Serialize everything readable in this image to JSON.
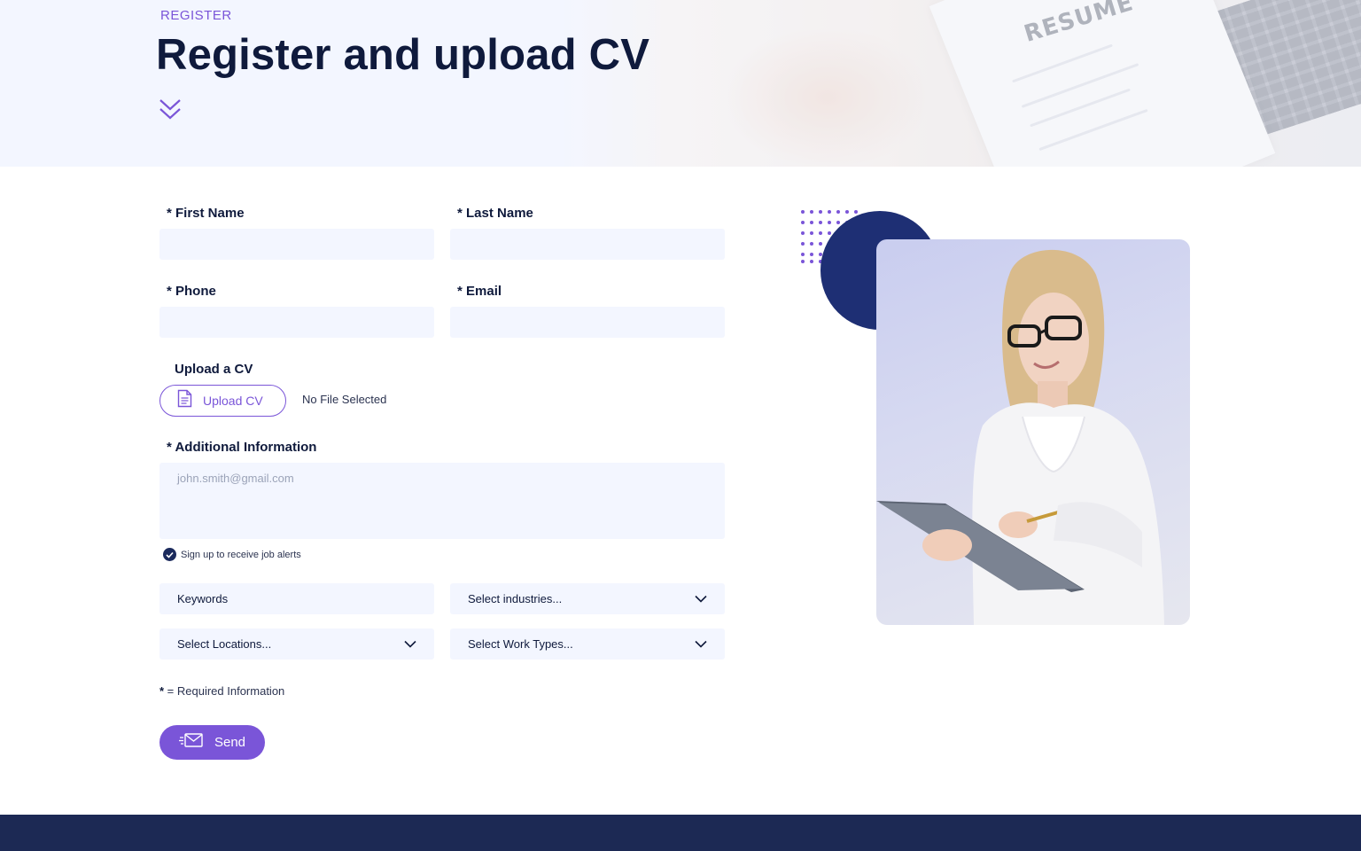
{
  "hero": {
    "eyebrow": "REGISTER",
    "title": "Register and upload CV",
    "background_text": "RESUME",
    "scroll_icon": "double-chevron-down-icon"
  },
  "form": {
    "first_name": {
      "label": "* First Name",
      "value": ""
    },
    "last_name": {
      "label": "* Last Name",
      "value": ""
    },
    "phone": {
      "label": "* Phone",
      "value": ""
    },
    "email": {
      "label": "* Email",
      "value": ""
    },
    "upload": {
      "label": "Upload a CV",
      "button_label": "Upload CV",
      "button_icon": "document-icon",
      "status": "No File Selected"
    },
    "additional_info": {
      "label": "* Additional Information",
      "placeholder": "john.smith@gmail.com",
      "value": ""
    },
    "job_alerts": {
      "label": "Sign up to receive job alerts",
      "checked": true
    },
    "keywords": {
      "label": "Keywords"
    },
    "industries": {
      "label": "Select industries..."
    },
    "locations": {
      "label": "Select Locations..."
    },
    "work_types": {
      "label": "Select Work Types..."
    },
    "required_note_star": "*",
    "required_note_text": " = Required Information",
    "send_label": "Send",
    "send_icon": "envelope-send-icon"
  },
  "colors": {
    "accent": "#7a55d8",
    "navy": "#1e2f74",
    "text": "#0f1a3c",
    "input_bg": "#f3f6ff",
    "footer": "#1c2954"
  }
}
